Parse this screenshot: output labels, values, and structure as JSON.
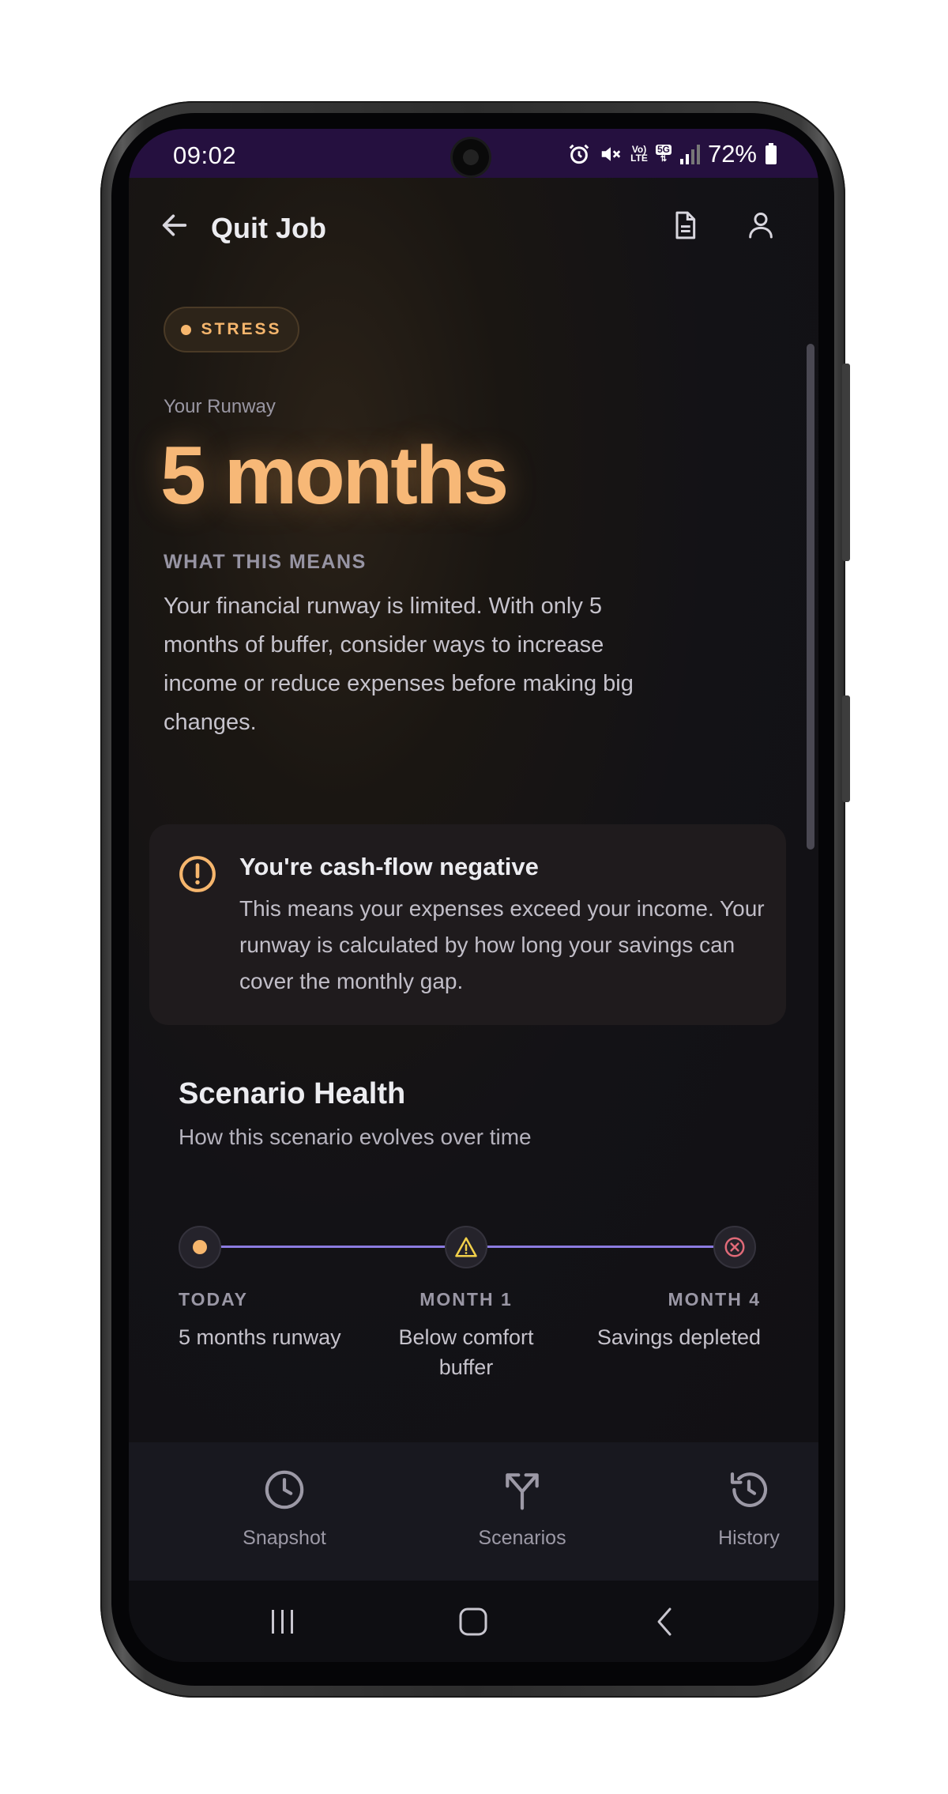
{
  "status_bar": {
    "time": "09:02",
    "battery": "72%",
    "volte_top": "Vo)",
    "volte_bottom": "LTE",
    "network": "5G"
  },
  "header": {
    "title": "Quit Job",
    "back_icon": "arrow-left-icon",
    "doc_icon": "document-icon",
    "profile_icon": "user-icon"
  },
  "summary": {
    "badge": "STRESS",
    "runway_label": "Your Runway",
    "runway_value": "5 months",
    "means_heading": "WHAT THIS MEANS",
    "means_text": "Your financial runway is limited. With only 5 months of buffer, consider ways to increase income or reduce expenses before making big changes."
  },
  "alert": {
    "title": "You're cash-flow negative",
    "body": "This means your expenses exceed your income. Your runway is calculated by how long your savings can cover the monthly gap."
  },
  "health": {
    "title": "Scenario Health",
    "subtitle": "How this scenario evolves over time",
    "timeline": [
      {
        "label": "TODAY",
        "desc": "5 months runway"
      },
      {
        "label": "MONTH 1",
        "desc": "Below comfort buffer"
      },
      {
        "label": "MONTH 4",
        "desc": "Savings depleted"
      }
    ]
  },
  "bottom_nav": [
    {
      "label": "Snapshot",
      "icon": "clock-icon"
    },
    {
      "label": "Scenarios",
      "icon": "split-arrows-icon"
    },
    {
      "label": "History",
      "icon": "history-icon"
    }
  ],
  "colors": {
    "accent": "#f7b877",
    "timeline_line": "#8b7be0",
    "status_bar": "#25103f",
    "background": "#111014"
  }
}
